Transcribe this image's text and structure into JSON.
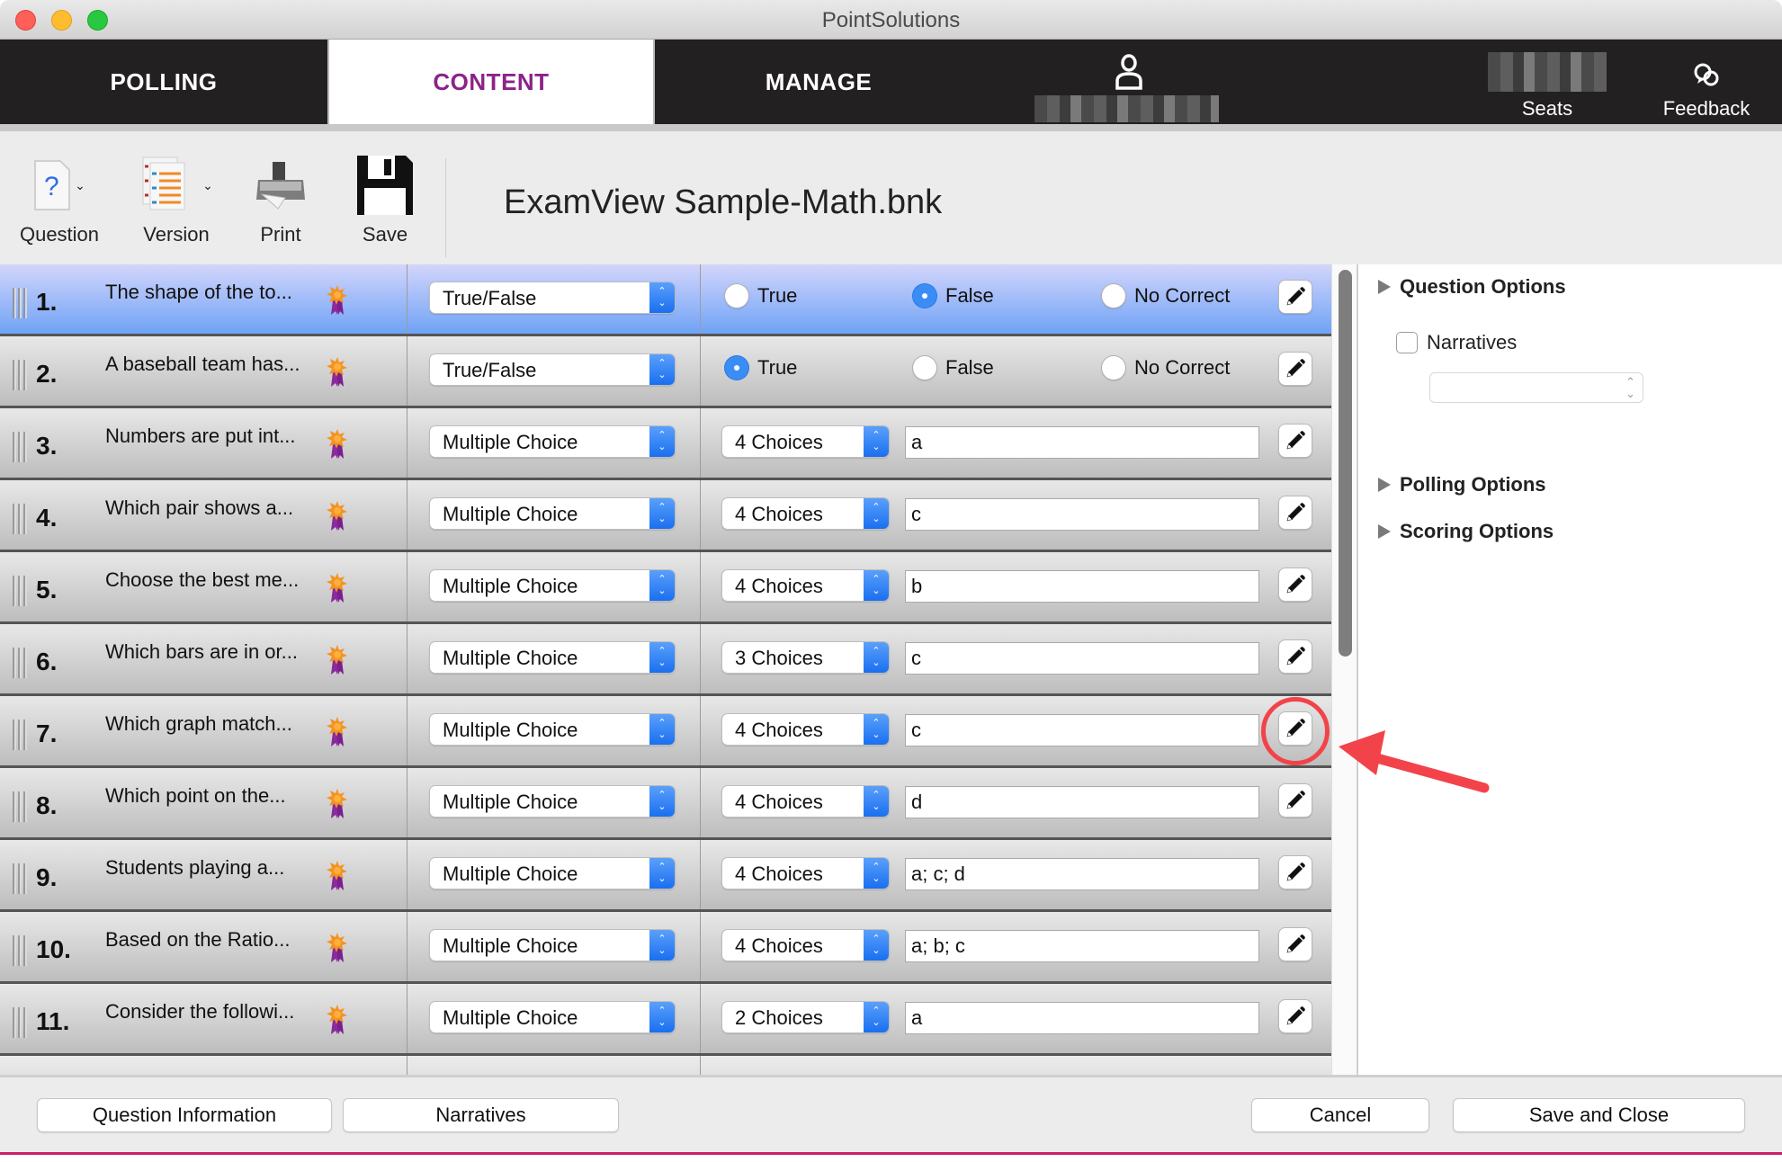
{
  "window": {
    "title": "PointSolutions"
  },
  "nav": {
    "tabs": [
      {
        "label": "POLLING",
        "active": false
      },
      {
        "label": "CONTENT",
        "active": true
      },
      {
        "label": "MANAGE",
        "active": false
      }
    ],
    "user_icon": "person-icon",
    "seats_label": "Seats",
    "feedback_label": "Feedback",
    "feedback_icon": "chat-bubbles-icon"
  },
  "toolbar": {
    "items": [
      {
        "label": "Question",
        "icon": "question-document-icon",
        "has_menu": true
      },
      {
        "label": "Version",
        "icon": "versions-list-icon",
        "has_menu": true
      },
      {
        "label": "Print",
        "icon": "printer-icon",
        "has_menu": false
      },
      {
        "label": "Save",
        "icon": "floppy-disk-icon",
        "has_menu": false
      }
    ],
    "document_title": "ExamView Sample-Math.bnk"
  },
  "questions": [
    {
      "number": "1.",
      "text": "The shape of the to...",
      "type": "True/False",
      "tf": {
        "options": [
          "True",
          "False",
          "No Correct"
        ],
        "selected": "False"
      },
      "selected_row": true
    },
    {
      "number": "2.",
      "text": "A baseball team has...",
      "type": "True/False",
      "tf": {
        "options": [
          "True",
          "False",
          "No Correct"
        ],
        "selected": "True"
      }
    },
    {
      "number": "3.",
      "text": "Numbers are put int...",
      "type": "Multiple Choice",
      "choices": "4 Choices",
      "answer": "a"
    },
    {
      "number": "4.",
      "text": "Which pair shows a...",
      "type": "Multiple Choice",
      "choices": "4 Choices",
      "answer": "c"
    },
    {
      "number": "5.",
      "text": "Choose the best me...",
      "type": "Multiple Choice",
      "choices": "4 Choices",
      "answer": "b"
    },
    {
      "number": "6.",
      "text": "Which bars are in or...",
      "type": "Multiple Choice",
      "choices": "3 Choices",
      "answer": "c"
    },
    {
      "number": "7.",
      "text": "Which graph match...",
      "type": "Multiple Choice",
      "choices": "4 Choices",
      "answer": "c",
      "highlighted": true
    },
    {
      "number": "8.",
      "text": "Which point on the...",
      "type": "Multiple Choice",
      "choices": "4 Choices",
      "answer": "d"
    },
    {
      "number": "9.",
      "text": "Students playing a...",
      "type": "Multiple Choice",
      "choices": "4 Choices",
      "answer": "a; c; d"
    },
    {
      "number": "10.",
      "text": "Based on the Ratio...",
      "type": "Multiple Choice",
      "choices": "4 Choices",
      "answer": "a; b; c"
    },
    {
      "number": "11.",
      "text": "Consider the followi...",
      "type": "Multiple Choice",
      "choices": "2 Choices",
      "answer": "a"
    }
  ],
  "right_panel": {
    "question_options": "Question Options",
    "narratives_checkbox": {
      "label": "Narratives",
      "checked": false
    },
    "narratives_select_value": "",
    "polling_options": "Polling Options",
    "scoring_options": "Scoring Options"
  },
  "bottom": {
    "question_information": "Question Information",
    "narratives": "Narratives",
    "cancel": "Cancel",
    "save_and_close": "Save and Close"
  },
  "colors": {
    "content_tab_text": "#8b2389",
    "selected_row_top": "#d3d5fb",
    "selected_row_bottom": "#6fa3f6",
    "stepper_blue": "#1a6ff0",
    "annotation_red": "#f2434a",
    "footer_line": "#cc1d6b"
  }
}
